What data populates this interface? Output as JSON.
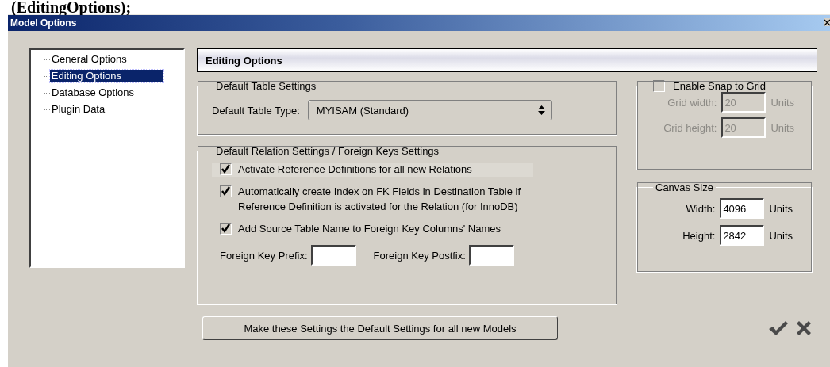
{
  "document_heading": "(EditingOptions);",
  "window": {
    "title": "Model Options"
  },
  "tree": {
    "items": [
      {
        "label": "General Options",
        "selected": false
      },
      {
        "label": "Editing Options",
        "selected": true
      },
      {
        "label": "Database Options",
        "selected": false
      },
      {
        "label": "Plugin Data",
        "selected": false
      }
    ]
  },
  "panel_title": "Editing Options",
  "table_settings": {
    "title": "Default Table Settings",
    "label": "Default Table Type:",
    "value": "MYISAM  (Standard)"
  },
  "relation_settings": {
    "title": "Default Relation Settings / Foreign Keys Settings",
    "checkboxes": [
      {
        "label": "Activate Reference Definitions for all new Relations",
        "checked": true
      },
      {
        "label": "Automatically create Index on FK Fields in Destination Table if\nReference Definition is activated for the Relation (for InnoDB)",
        "checked": true
      },
      {
        "label": "Add Source Table Name to Foreign Key Columns' Names",
        "checked": true
      }
    ],
    "prefix": {
      "label": "Foreign Key Prefix:"
    },
    "postfix": {
      "label": "Foreign Key Postfix:"
    }
  },
  "snap": {
    "label": "Enable Snap to Grid",
    "checked": false,
    "fields": [
      {
        "label": "Grid width:",
        "value": "20",
        "unit": "Units",
        "disabled": true
      },
      {
        "label": "Grid height:",
        "value": "20",
        "unit": "Units",
        "disabled": true
      }
    ]
  },
  "canvas": {
    "title": "Canvas Size",
    "fields": [
      {
        "label": "Width:",
        "value": "4096",
        "unit": "Units",
        "disabled": false
      },
      {
        "label": "Height:",
        "value": "2842",
        "unit": "Units",
        "disabled": false
      }
    ]
  },
  "default_button": "Make these Settings the Default Settings for all new Models"
}
